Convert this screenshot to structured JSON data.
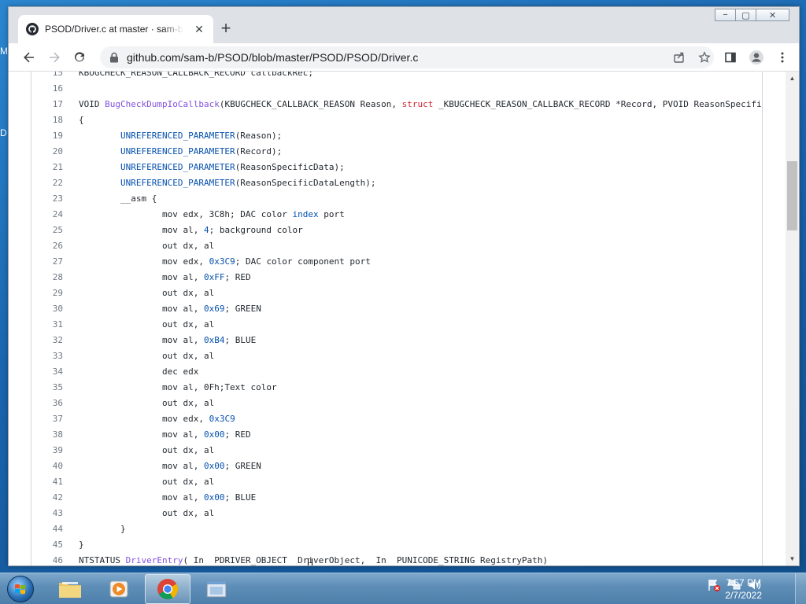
{
  "desktop": {
    "glyph_1": "M",
    "glyph_2": "D"
  },
  "tab": {
    "title": "PSOD/Driver.c at master · sam-b/PSOD",
    "close": "✕"
  },
  "toolbar": {
    "url": "github.com/sam-b/PSOD/blob/master/PSOD/PSOD/Driver.c"
  },
  "window_controls": {
    "minimize": "−",
    "maximize": "▢",
    "close": "✕"
  },
  "code": [
    {
      "n": "15",
      "t": [
        [
          "",
          "KBUGCHECK_REASON_CALLBACK_RECORD callbackRec;"
        ]
      ]
    },
    {
      "n": "16",
      "t": []
    },
    {
      "n": "17",
      "t": [
        [
          "",
          "VOID "
        ],
        [
          "fn",
          "BugCheckDumpIoCallback"
        ],
        [
          "",
          "(KBUGCHECK_CALLBACK_REASON Reason, "
        ],
        [
          "kw",
          "struct"
        ],
        [
          "",
          " _KBUGCHECK_REASON_CALLBACK_RECORD *Record, PVOID ReasonSpecificData, ULONG ReasonSpecificDataLength) {"
        ]
      ]
    },
    {
      "n": "18",
      "t": [
        [
          "",
          "{"
        ]
      ]
    },
    {
      "n": "19",
      "t": [
        [
          "",
          "        "
        ],
        [
          "mac",
          "UNREFERENCED_PARAMETER"
        ],
        [
          "",
          "(Reason);"
        ]
      ]
    },
    {
      "n": "20",
      "t": [
        [
          "",
          "        "
        ],
        [
          "mac",
          "UNREFERENCED_PARAMETER"
        ],
        [
          "",
          "(Record);"
        ]
      ]
    },
    {
      "n": "21",
      "t": [
        [
          "",
          "        "
        ],
        [
          "mac",
          "UNREFERENCED_PARAMETER"
        ],
        [
          "",
          "(ReasonSpecificData);"
        ]
      ]
    },
    {
      "n": "22",
      "t": [
        [
          "",
          "        "
        ],
        [
          "mac",
          "UNREFERENCED_PARAMETER"
        ],
        [
          "",
          "(ReasonSpecificDataLength);"
        ]
      ]
    },
    {
      "n": "23",
      "t": [
        [
          "",
          "        __asm {"
        ]
      ]
    },
    {
      "n": "24",
      "t": [
        [
          "",
          "                mov edx, 3C8h; DAC color "
        ],
        [
          "mac",
          "index"
        ],
        [
          "",
          " port"
        ]
      ]
    },
    {
      "n": "25",
      "t": [
        [
          "",
          "                mov al, "
        ],
        [
          "num",
          "4"
        ],
        [
          "",
          "; background color"
        ]
      ]
    },
    {
      "n": "26",
      "t": [
        [
          "",
          "                out dx, al"
        ]
      ]
    },
    {
      "n": "27",
      "t": [
        [
          "",
          "                mov edx, "
        ],
        [
          "num",
          "0x3C9"
        ],
        [
          "",
          "; DAC color component port"
        ]
      ]
    },
    {
      "n": "28",
      "t": [
        [
          "",
          "                mov al, "
        ],
        [
          "num",
          "0xFF"
        ],
        [
          "",
          "; RED"
        ]
      ]
    },
    {
      "n": "29",
      "t": [
        [
          "",
          "                out dx, al"
        ]
      ]
    },
    {
      "n": "30",
      "t": [
        [
          "",
          "                mov al, "
        ],
        [
          "num",
          "0x69"
        ],
        [
          "",
          "; GREEN"
        ]
      ]
    },
    {
      "n": "31",
      "t": [
        [
          "",
          "                out dx, al"
        ]
      ]
    },
    {
      "n": "32",
      "t": [
        [
          "",
          "                mov al, "
        ],
        [
          "num",
          "0xB4"
        ],
        [
          "",
          "; BLUE"
        ]
      ]
    },
    {
      "n": "33",
      "t": [
        [
          "",
          "                out dx, al"
        ]
      ]
    },
    {
      "n": "34",
      "t": [
        [
          "",
          "                dec edx"
        ]
      ]
    },
    {
      "n": "35",
      "t": [
        [
          "",
          "                mov al, 0Fh;Text color"
        ]
      ]
    },
    {
      "n": "36",
      "t": [
        [
          "",
          "                out dx, al"
        ]
      ]
    },
    {
      "n": "37",
      "t": [
        [
          "",
          "                mov edx, "
        ],
        [
          "num",
          "0x3C9"
        ]
      ]
    },
    {
      "n": "38",
      "t": [
        [
          "",
          "                mov al, "
        ],
        [
          "num",
          "0x00"
        ],
        [
          "",
          "; RED"
        ]
      ]
    },
    {
      "n": "39",
      "t": [
        [
          "",
          "                out dx, al"
        ]
      ]
    },
    {
      "n": "40",
      "t": [
        [
          "",
          "                mov al, "
        ],
        [
          "num",
          "0x00"
        ],
        [
          "",
          "; GREEN"
        ]
      ]
    },
    {
      "n": "41",
      "t": [
        [
          "",
          "                out dx, al"
        ]
      ]
    },
    {
      "n": "42",
      "t": [
        [
          "",
          "                mov al, "
        ],
        [
          "num",
          "0x00"
        ],
        [
          "",
          "; BLUE"
        ]
      ]
    },
    {
      "n": "43",
      "t": [
        [
          "",
          "                out dx, al"
        ]
      ]
    },
    {
      "n": "44",
      "t": [
        [
          "",
          "        }"
        ]
      ]
    },
    {
      "n": "45",
      "t": [
        [
          "",
          "}"
        ]
      ]
    },
    {
      "n": "46",
      "t": [
        [
          "",
          "NTSTATUS "
        ],
        [
          "fn",
          "DriverEntry"
        ],
        [
          "",
          "( In  PDRIVER_OBJECT  DriverObject,  In  PUNICODE_STRING RegistryPath)"
        ]
      ]
    }
  ],
  "taskbar": {
    "clock_time": "7:57 PM",
    "clock_date": "2/7/2022"
  },
  "colors": {
    "keyword": "#cf222e",
    "function": "#8250df",
    "macro": "#0550ae"
  }
}
